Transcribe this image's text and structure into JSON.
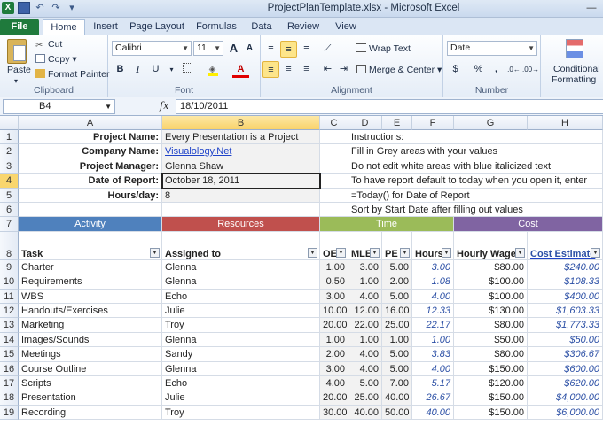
{
  "window": {
    "title": "ProjectPlanTemplate.xlsx - Microsoft Excel"
  },
  "tabs": [
    "File",
    "Home",
    "Insert",
    "Page Layout",
    "Formulas",
    "Data",
    "Review",
    "View"
  ],
  "ribbon": {
    "clipboard": {
      "label": "Clipboard",
      "paste": "Paste",
      "cut": "Cut",
      "copy": "Copy",
      "format_painter": "Format Painter"
    },
    "font": {
      "label": "Font",
      "name": "Calibri",
      "size": "11",
      "grow": "A",
      "shrink": "A",
      "bold": "B",
      "italic": "I",
      "underline": "U",
      "font_color_letter": "A"
    },
    "alignment": {
      "label": "Alignment",
      "wrap": "Wrap Text",
      "merge": "Merge & Center"
    },
    "number": {
      "label": "Number",
      "format": "Date",
      "currency": "$",
      "percent": "%",
      "comma": ","
    },
    "styles": {
      "conditional": "Conditional",
      "formatting": "Formatting"
    }
  },
  "formula_bar": {
    "name_box": "B4",
    "fx": "fx",
    "value": "18/10/2011"
  },
  "columns": [
    "A",
    "B",
    "C",
    "D",
    "E",
    "F",
    "G",
    "H"
  ],
  "rows": [
    "1",
    "2",
    "3",
    "4",
    "5",
    "6",
    "7",
    "8",
    "9",
    "10",
    "11",
    "12",
    "13",
    "14",
    "15",
    "16",
    "17",
    "18",
    "19"
  ],
  "project": {
    "labels": [
      "Project Name:",
      "Company Name:",
      "Project Manager:",
      "Date of Report:",
      "Hours/day:"
    ],
    "values": [
      "Every Presentation is a Project",
      "Visualology.Net",
      "Glenna Shaw",
      "October 18, 2011",
      "8"
    ]
  },
  "instructions": [
    "Instructions:",
    "Fill in Grey areas with your values",
    "Do not edit white areas with blue italicized text",
    "To have report default to today when you open it, enter",
    "=Today() for Date of Report",
    "Sort by Start Date after filling out values"
  ],
  "bands": {
    "activity": {
      "label": "Activity",
      "color": "#4f81bd"
    },
    "resources": {
      "label": "Resources",
      "color": "#c0504d"
    },
    "time": {
      "label": "Time",
      "color": "#9bbb59"
    },
    "cost": {
      "label": "Cost",
      "color": "#8064a2"
    }
  },
  "headers": [
    "Task",
    "Assigned to",
    "OE",
    "MLE",
    "PE",
    "Hours",
    "Hourly Wage",
    "Cost Estimate"
  ],
  "tasks": [
    [
      "Charter",
      "Glenna",
      "1.00",
      "3.00",
      "5.00",
      "3.00",
      "$80.00",
      "$240.00"
    ],
    [
      "Requirements",
      "Glenna",
      "0.50",
      "1.00",
      "2.00",
      "1.08",
      "$100.00",
      "$108.33"
    ],
    [
      "WBS",
      "Echo",
      "3.00",
      "4.00",
      "5.00",
      "4.00",
      "$100.00",
      "$400.00"
    ],
    [
      "Handouts/Exercises",
      "Julie",
      "10.00",
      "12.00",
      "16.00",
      "12.33",
      "$130.00",
      "$1,603.33"
    ],
    [
      "Marketing",
      "Troy",
      "20.00",
      "22.00",
      "25.00",
      "22.17",
      "$80.00",
      "$1,773.33"
    ],
    [
      "Images/Sounds",
      "Glenna",
      "1.00",
      "1.00",
      "1.00",
      "1.00",
      "$50.00",
      "$50.00"
    ],
    [
      "Meetings",
      "Sandy",
      "2.00",
      "4.00",
      "5.00",
      "3.83",
      "$80.00",
      "$306.67"
    ],
    [
      "Course Outline",
      "Glenna",
      "3.00",
      "4.00",
      "5.00",
      "4.00",
      "$150.00",
      "$600.00"
    ],
    [
      "Scripts",
      "Echo",
      "4.00",
      "5.00",
      "7.00",
      "5.17",
      "$120.00",
      "$620.00"
    ],
    [
      "Presentation",
      "Julie",
      "20.00",
      "25.00",
      "40.00",
      "26.67",
      "$150.00",
      "$4,000.00"
    ],
    [
      "Recording",
      "Troy",
      "30.00",
      "40.00",
      "50.00",
      "40.00",
      "$150.00",
      "$6,000.00"
    ]
  ]
}
